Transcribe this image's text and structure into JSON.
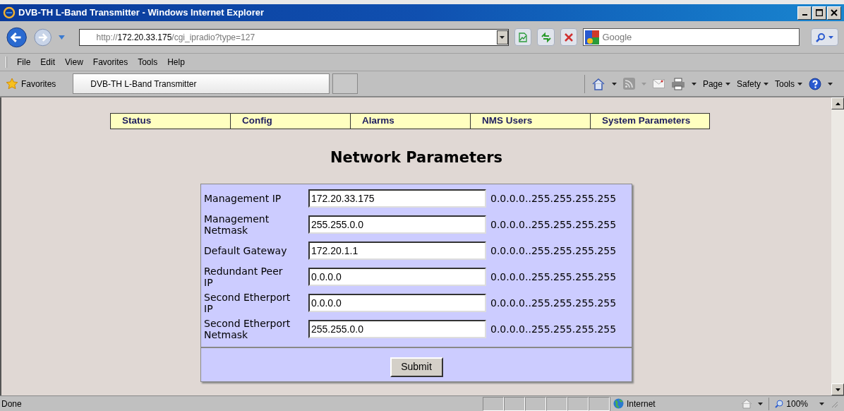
{
  "window": {
    "title": "DVB-TH L-Band Transmitter - Windows Internet Explorer"
  },
  "address": {
    "scheme": "http://",
    "host": "172.20.33.175",
    "path": "/cgi_ipradio?type=127"
  },
  "search": {
    "placeholder": "Google"
  },
  "menu": [
    "File",
    "Edit",
    "View",
    "Favorites",
    "Tools",
    "Help"
  ],
  "favorites_bar": {
    "label": "Favorites",
    "tab": "DVB-TH L-Band Transmitter"
  },
  "command_bar": [
    "Page",
    "Safety",
    "Tools"
  ],
  "nav": [
    "Status",
    "Config",
    "Alarms",
    "NMS Users",
    "System Parameters"
  ],
  "heading": "Network Parameters",
  "fields": [
    {
      "label": "Management IP",
      "value": "172.20.33.175",
      "range": "0.0.0.0..255.255.255.255"
    },
    {
      "label": "Management Netmask",
      "value": "255.255.0.0",
      "range": "0.0.0.0..255.255.255.255"
    },
    {
      "label": "Default Gateway",
      "value": "172.20.1.1",
      "range": "0.0.0.0..255.255.255.255"
    },
    {
      "label": "Redundant Peer IP",
      "value": "0.0.0.0",
      "range": "0.0.0.0..255.255.255.255"
    },
    {
      "label": "Second Etherport IP",
      "value": "0.0.0.0",
      "range": "0.0.0.0..255.255.255.255"
    },
    {
      "label": "Second Etherport Netmask",
      "value": "255.255.0.0",
      "range": "0.0.0.0..255.255.255.255"
    }
  ],
  "submit": "Submit",
  "status_bar": {
    "text": "Done",
    "zone": "Internet",
    "zoom": "100%"
  }
}
